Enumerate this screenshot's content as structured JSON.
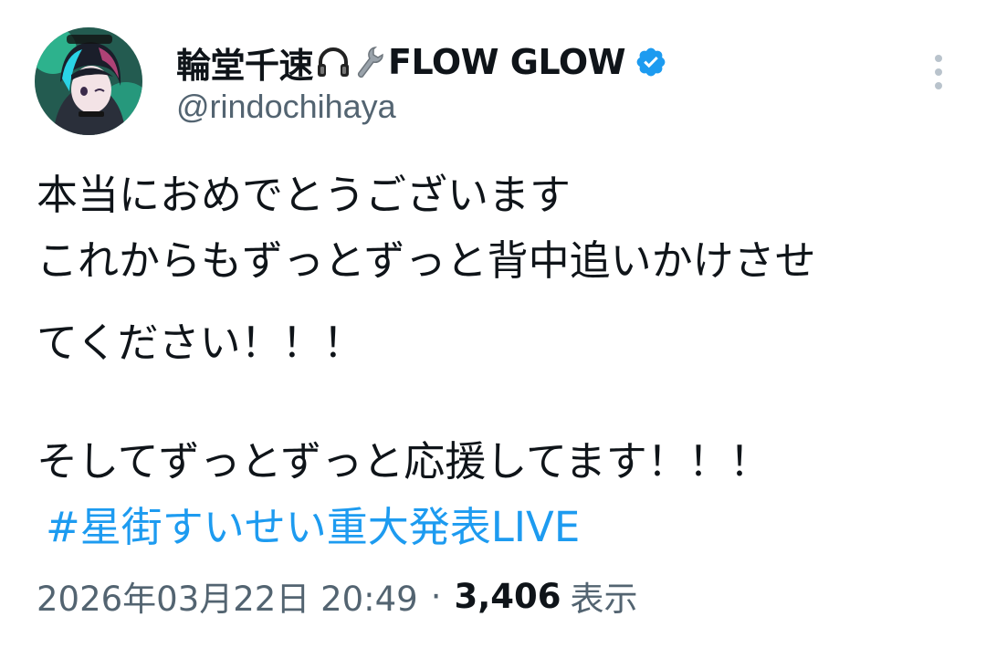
{
  "author": {
    "display_name": "輪堂千速",
    "name_emojis": [
      "headphones-emoji",
      "wrench-emoji"
    ],
    "brand_name": "FLOW GLOW",
    "handle": "@rindochihaya",
    "verified": true,
    "verified_color": "#1d9bf0"
  },
  "tweet": {
    "lines": [
      "本当におめでとうございます",
      "これからもずっとずっと背中追いかけさせ",
      "てください！！！",
      "そしてずっとずっと応援してます！！！"
    ],
    "hashtag": "#星街すいせい重大発表LIVE"
  },
  "meta": {
    "timestamp": "2026年03月22日 20:49",
    "separator": "·",
    "views_count": "3,406",
    "views_label": "表示"
  },
  "colors": {
    "text": "#0f1419",
    "secondary": "#536471",
    "link": "#1d9bf0"
  }
}
